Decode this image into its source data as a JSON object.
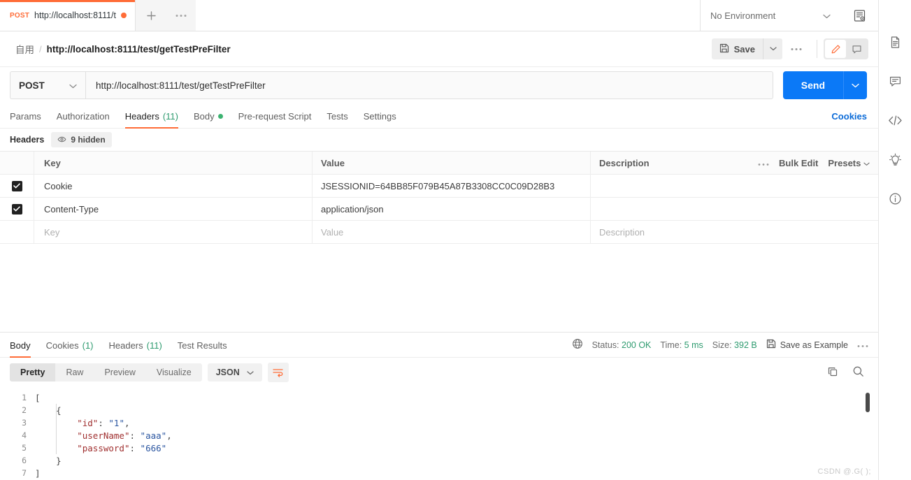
{
  "tabbar": {
    "request_tab": {
      "method": "POST",
      "name": "http://localhost:8111/t",
      "unsaved": true
    },
    "new_tab_label": "+",
    "more_label": "000",
    "environment": {
      "selected": "No Environment"
    }
  },
  "breadcrumb": {
    "collection": "自用",
    "separator": "/",
    "request_name": "http://localhost:8111/test/getTestPreFilter"
  },
  "toolbar": {
    "save_label": "Save",
    "more_label": "000"
  },
  "request": {
    "method": "POST",
    "url": "http://localhost:8111/test/getTestPreFilter",
    "send_label": "Send",
    "tabs": [
      {
        "label": "Params",
        "count": "",
        "active": false
      },
      {
        "label": "Authorization",
        "count": "",
        "active": false
      },
      {
        "label": "Headers",
        "count": "(11)",
        "active": true
      },
      {
        "label": "Body",
        "count": "",
        "active": false,
        "dot": true
      },
      {
        "label": "Pre-request Script",
        "count": "",
        "active": false
      },
      {
        "label": "Tests",
        "count": "",
        "active": false
      },
      {
        "label": "Settings",
        "count": "",
        "active": false
      }
    ],
    "cookies_link": "Cookies"
  },
  "headers_section": {
    "title": "Headers",
    "hidden_label": "9 hidden",
    "columns": {
      "key": "Key",
      "value": "Value",
      "description": "Description"
    },
    "actions": {
      "dots": "000",
      "bulk_edit": "Bulk Edit",
      "presets": "Presets"
    },
    "rows": [
      {
        "checked": true,
        "key": "Cookie",
        "value": "JSESSIONID=64BB85F079B45A87B3308CC0C09D28B3",
        "description": ""
      },
      {
        "checked": true,
        "key": "Content-Type",
        "value": "application/json",
        "description": ""
      }
    ],
    "placeholder_row": {
      "key": "Key",
      "value": "Value",
      "description": "Description"
    }
  },
  "response": {
    "tabs": [
      {
        "label": "Body",
        "count": "",
        "active": true
      },
      {
        "label": "Cookies",
        "count": "(1)",
        "active": false
      },
      {
        "label": "Headers",
        "count": "(11)",
        "active": false
      },
      {
        "label": "Test Results",
        "count": "",
        "active": false
      }
    ],
    "status_label": "Status:",
    "status_value": "200 OK",
    "time_label": "Time:",
    "time_value": "5 ms",
    "size_label": "Size:",
    "size_value": "392 B",
    "save_example_label": "Save as Example",
    "more_label": "000",
    "view_modes": [
      {
        "label": "Pretty",
        "active": true
      },
      {
        "label": "Raw",
        "active": false
      },
      {
        "label": "Preview",
        "active": false
      },
      {
        "label": "Visualize",
        "active": false
      }
    ],
    "format": "JSON",
    "body_lines": [
      {
        "n": "1",
        "indent": 0,
        "parts": [
          {
            "t": "[",
            "c": "p"
          }
        ]
      },
      {
        "n": "2",
        "indent": 1,
        "parts": [
          {
            "t": "{",
            "c": "p"
          }
        ]
      },
      {
        "n": "3",
        "indent": 2,
        "parts": [
          {
            "t": "\"id\"",
            "c": "k"
          },
          {
            "t": ": ",
            "c": "p"
          },
          {
            "t": "\"1\"",
            "c": "s"
          },
          {
            "t": ",",
            "c": "p"
          }
        ]
      },
      {
        "n": "4",
        "indent": 2,
        "parts": [
          {
            "t": "\"userName\"",
            "c": "k"
          },
          {
            "t": ": ",
            "c": "p"
          },
          {
            "t": "\"aaa\"",
            "c": "s"
          },
          {
            "t": ",",
            "c": "p"
          }
        ]
      },
      {
        "n": "5",
        "indent": 2,
        "parts": [
          {
            "t": "\"password\"",
            "c": "k"
          },
          {
            "t": ": ",
            "c": "p"
          },
          {
            "t": "\"666\"",
            "c": "s"
          }
        ]
      },
      {
        "n": "6",
        "indent": 1,
        "parts": [
          {
            "t": "}",
            "c": "p"
          }
        ]
      },
      {
        "n": "7",
        "indent": 0,
        "parts": [
          {
            "t": "]",
            "c": "p"
          }
        ]
      }
    ]
  },
  "watermark": "CSDN @.G( );",
  "colors": {
    "accent_orange": "#ff6c37",
    "send_blue": "#0b79f7",
    "link_blue": "#0b6bd8",
    "status_green": "#2e9b6f",
    "json_key": "#a03030",
    "json_string": "#2a55a0"
  }
}
